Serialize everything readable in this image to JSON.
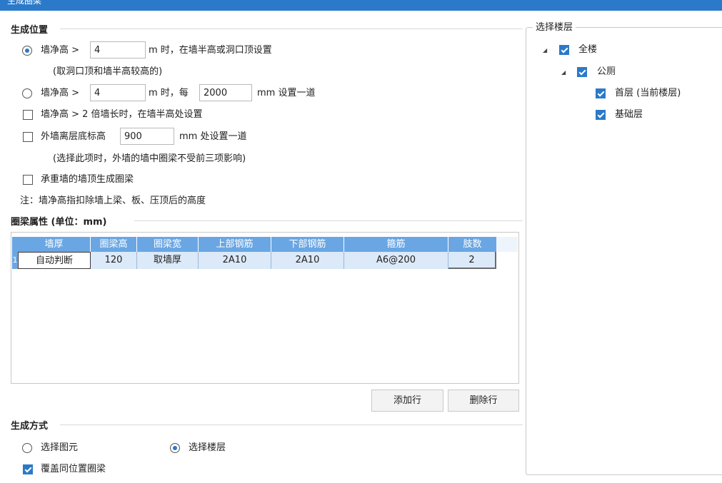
{
  "window": {
    "title": "生成圈梁"
  },
  "position_section": {
    "title": "生成位置",
    "option1": {
      "prefix": "墙净高 >",
      "value": "4",
      "suffix": "m 时，在墙半高或洞口顶设置",
      "note": "(取洞口顶和墙半高较高的)",
      "selected": true
    },
    "option2": {
      "prefix": "墙净高 >",
      "value": "4",
      "middle": "m 时，每",
      "spacing": "2000",
      "suffix": "mm 设置一道",
      "selected": false
    },
    "check1": {
      "label": "墙净高 > 2 倍墙长时，在墙半高处设置",
      "checked": false
    },
    "check2": {
      "prefix": "外墙离层底标高",
      "value": "900",
      "suffix": "mm 处设置一道",
      "note": "(选择此项时，外墙的墙中圈梁不受前三项影响)",
      "checked": false
    },
    "check3": {
      "label": "承重墙的墙顶生成圈梁",
      "checked": false
    },
    "footnote": "注：墙净高指扣除墙上梁、板、压顶后的高度"
  },
  "props_section": {
    "title": "圈梁属性 (单位：mm)",
    "columns": [
      "墙厚",
      "圈梁高",
      "圈梁宽",
      "上部钢筋",
      "下部钢筋",
      "箍筋",
      "肢数"
    ],
    "rows": [
      {
        "index": "1",
        "cells": [
          "自动判断",
          "120",
          "取墙厚",
          "2A10",
          "2A10",
          "A6@200",
          "2"
        ]
      }
    ],
    "add_row": "添加行",
    "delete_row": "删除行"
  },
  "method_section": {
    "title": "生成方式",
    "opt_elements": {
      "label": "选择图元",
      "selected": false
    },
    "opt_floors": {
      "label": "选择楼层",
      "selected": true
    },
    "overwrite": {
      "label": "覆盖同位置圈梁",
      "checked": true
    }
  },
  "floor_panel": {
    "title": "选择楼层",
    "tree": {
      "root": {
        "label": "全楼",
        "checked": true,
        "expanded": true
      },
      "building": {
        "label": "公厕",
        "checked": true,
        "expanded": true
      },
      "floors": [
        {
          "label": "首层 (当前楼层)",
          "checked": true
        },
        {
          "label": "基础层",
          "checked": true
        }
      ]
    }
  },
  "colors": {
    "accent": "#2b79c9",
    "header": "#6aa6e3",
    "row_highlight": "#dbe9f8"
  }
}
